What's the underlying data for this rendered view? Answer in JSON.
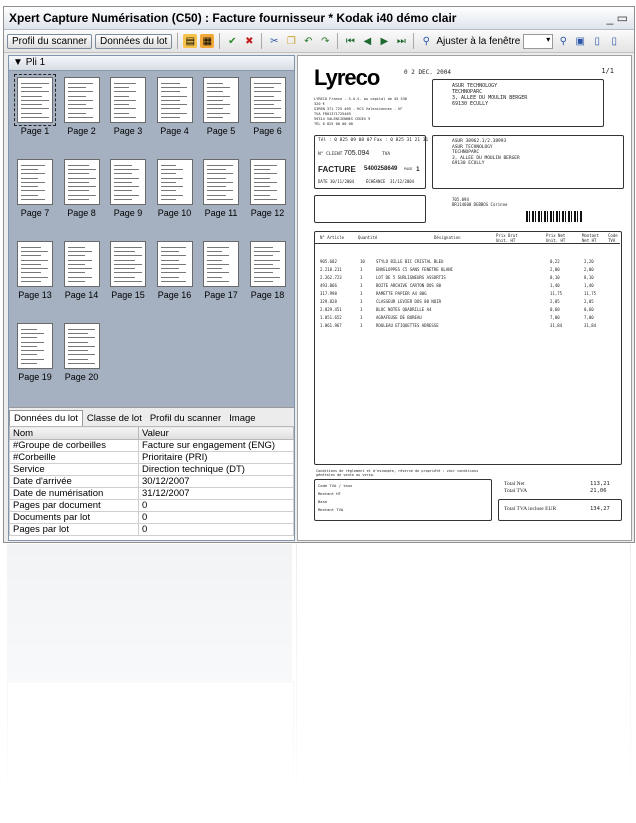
{
  "window": {
    "title": "Xpert Capture  Numérisation  (C50)  :  Facture fournisseur * Kodak i40 démo clair",
    "minimize": "_ ▭"
  },
  "toolbar": {
    "scanner_profile_label": "Profil du scanner",
    "lot_data_label": "Données du lot",
    "fit_window_label": "Ajuster à la fenêtre"
  },
  "lot": {
    "name": "Pli 1",
    "pages": [
      "Page 1",
      "Page 2",
      "Page 3",
      "Page 4",
      "Page 5",
      "Page 6",
      "Page 7",
      "Page 8",
      "Page 9",
      "Page 10",
      "Page 11",
      "Page 12",
      "Page 13",
      "Page 14",
      "Page 15",
      "Page 16",
      "Page 17",
      "Page 18",
      "Page 19",
      "Page 20"
    ]
  },
  "tabs": [
    "Données du lot",
    "Classe de lot",
    "Profil du scanner",
    "Image"
  ],
  "properties": {
    "col_name": "Nom",
    "col_value": "Valeur",
    "rows": [
      {
        "name": "#Groupe de corbeilles",
        "value": "Facture sur engagement (ENG)"
      },
      {
        "name": "#Corbeille",
        "value": "Prioritaire (PRI)"
      },
      {
        "name": "Service",
        "value": "Direction technique (DT)"
      },
      {
        "name": "Date d'arrivée",
        "value": "30/12/2007"
      },
      {
        "name": "Date de numérisation",
        "value": "31/12/2007"
      },
      {
        "name": "Pages par document",
        "value": "0"
      },
      {
        "name": "Documents par lot",
        "value": "0"
      },
      {
        "name": "Pages par lot",
        "value": "0"
      }
    ]
  },
  "invoice": {
    "logo": "Lyreco",
    "date_stamp": "0 2 DEC. 2004",
    "page_mark": "1/1",
    "vendor_block": [
      "LYRECO France - S.A.S. au capital de 45 536 320 €",
      "SIREN 371 725 469 - RCS Valenciennes - N° TVA FR01371725469",
      "59314 VALENCIENNES CEDEX 9",
      "TÉL 0 825 00 00 00"
    ],
    "recipient_top": [
      "ASUR TECHNOLOGY",
      "TECHNOPARC",
      "3, ALLEE DU MOULIN BERGER",
      "69130 ECULLY"
    ],
    "tel": "Tél : 0 825 09 08 07",
    "fax": "Fax : 0 825 31 21 31",
    "client_label": "N° CLIENT",
    "client_no": "705.094",
    "tva_label": "TVA",
    "doc_type": "FACTURE",
    "invoice_no": "5400258649",
    "page_label": "PAGE",
    "page_no": "1",
    "date_label": "DATE",
    "date_value": "30/11/2004",
    "due_label": "ÉCHÉANCE",
    "due_value": "31/12/2004",
    "recipient_bill": [
      "ASUR 38962.1/2.38993",
      "ASUR TECHNOLOGY",
      "TECHNOPARC",
      "3, ALLEE DU MOULIN BERGER",
      "69130 ECULLY"
    ],
    "order_ref": [
      "705.094",
      "BR114600 DEBBOS Corinne"
    ],
    "columns": [
      "N° Article",
      "Quantité",
      "Désignation",
      "Prix Brut Unit. HT",
      "Prix Net Unit. HT",
      "Montant Net HT",
      "Code TVA"
    ],
    "items": [
      {
        "ref": "905.682",
        "qty": "10",
        "desc": "STYLO BILLE BIC CRISTAL BLEU",
        "net": "0,22",
        "total": "2,20"
      },
      {
        "ref": "2.218.211",
        "qty": "1",
        "desc": "ENVELOPPES C5 SANS FENETRE BLANC",
        "net": "2,00",
        "total": "2,00"
      },
      {
        "ref": "2.262.723",
        "qty": "1",
        "desc": "LOT DE 5 SURLIGNEURS ASSORTIS",
        "net": "8,10",
        "total": "8,10"
      },
      {
        "ref": "493.066",
        "qty": "1",
        "desc": "BOITE ARCHIVE CARTON DOS 80",
        "net": "1,40",
        "total": "1,40"
      },
      {
        "ref": "317.998",
        "qty": "1",
        "desc": "RAMETTE PAPIER A4 80G",
        "net": "11,75",
        "total": "11,75"
      },
      {
        "ref": "329.828",
        "qty": "1",
        "desc": "CLASSEUR LEVIER DOS 80 NOIR",
        "net": "2,05",
        "total": "2,05"
      },
      {
        "ref": "2.029.451",
        "qty": "1",
        "desc": "BLOC NOTES QUADRILLE A4",
        "net": "0,60",
        "total": "0,60"
      },
      {
        "ref": "1.051.652",
        "qty": "1",
        "desc": "AGRAFEUSE DE BUREAU",
        "net": "7,00",
        "total": "7,00"
      },
      {
        "ref": "1.061.967",
        "qty": "1",
        "desc": "ROULEAU ETIQUETTES ADRESSE",
        "net": "31,84",
        "total": "31,84"
      }
    ],
    "footer_note": "Conditions de règlement et d'escompte, réserve de propriété : voir conditions générales de vente au verso.",
    "vat_header": [
      "Code TVA / taux",
      "1",
      "19,60",
      "3",
      "5,50"
    ],
    "vat_rows": [
      {
        "label": "Montant HT",
        "a": "",
        "b": "",
        "c": ""
      },
      {
        "label": "Base",
        "a": "",
        "b": "",
        "c": ""
      },
      {
        "label": "Montant TVA",
        "a": "",
        "b": "",
        "c": ""
      }
    ],
    "total_net_label": "Total Net",
    "total_net": "113,21",
    "total_tva_label": "Total TVA",
    "total_tva": "21,06",
    "total_ttc_label": "Total TVA incluse EUR",
    "total_ttc": "134,27"
  }
}
